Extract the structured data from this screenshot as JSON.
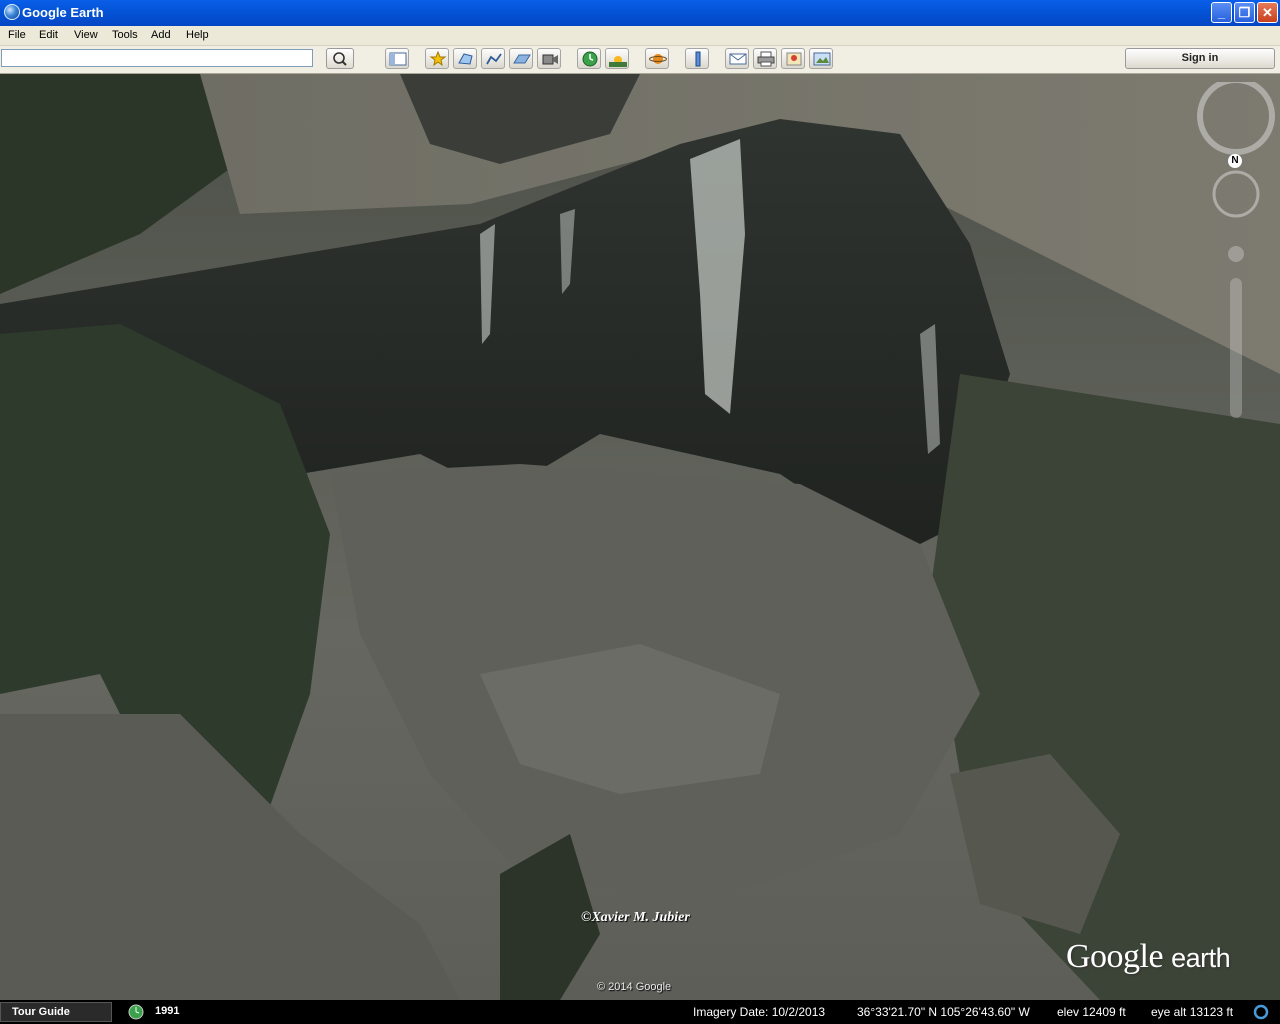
{
  "window": {
    "title": "Google Earth"
  },
  "menu": [
    "File",
    "Edit",
    "View",
    "Tools",
    "Add",
    "Help"
  ],
  "search": {
    "placeholder": ""
  },
  "toolbar": {
    "sign_in_label": "Sign in",
    "icons": [
      "sidebar-toggle-icon",
      "placemark-icon",
      "polygon-icon",
      "path-icon",
      "image-overlay-icon",
      "record-tour-icon",
      "historical-imagery-icon",
      "sunlight-icon",
      "planets-icon",
      "ruler-icon",
      "email-icon",
      "print-icon",
      "view-in-maps-icon",
      "save-image-icon"
    ]
  },
  "map": {
    "watermark": "©Xavier M. Jubier",
    "copyright": "© 2014 Google",
    "logo_google": "Google",
    "logo_earth": "earth",
    "compass_letter": "N"
  },
  "status": {
    "tour_guide": "Tour Guide",
    "historical_year": "1991",
    "imagery_date": "Imagery Date: 10/2/2013",
    "coordinates": "36°33'21.70\" N  105°26'43.60\" W",
    "elevation": "elev 12409 ft",
    "eye_alt": "eye alt  13123 ft"
  },
  "colors": {
    "titlebar": "#0454d8",
    "menubar": "#ece9d8",
    "toolbar": "#f1efe4",
    "status": "#000000"
  }
}
